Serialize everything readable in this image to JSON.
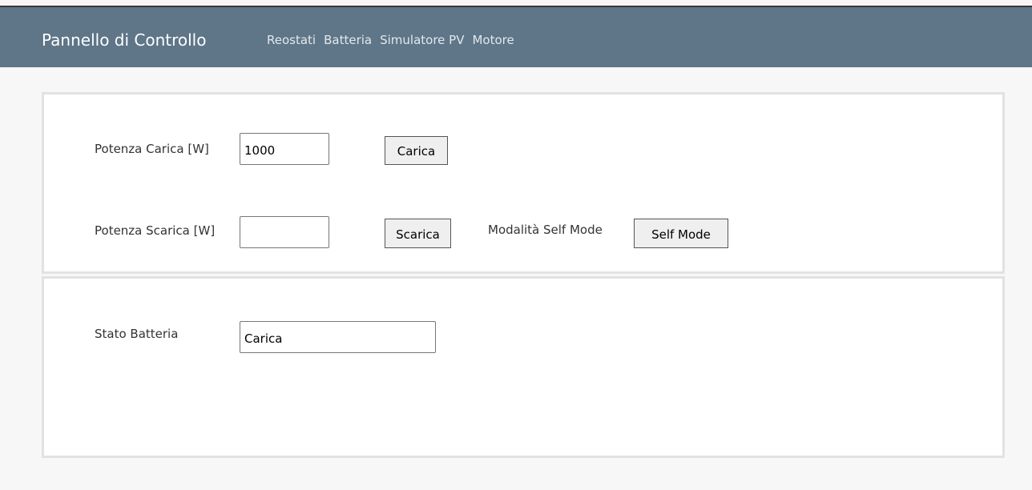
{
  "navbar": {
    "brand": "Pannello di Controllo",
    "links": [
      "Reostati",
      "Batteria",
      "Simulatore PV",
      "Motore"
    ]
  },
  "controls": {
    "charge_power_label": "Potenza Carica [W]",
    "charge_power_value": "1000",
    "charge_button": "Carica",
    "discharge_power_label": "Potenza Scarica [W]",
    "discharge_power_value": "",
    "discharge_button": "Scarica",
    "self_mode_label": "Modalità Self Mode",
    "self_mode_button": "Self Mode"
  },
  "status": {
    "battery_state_label": "Stato Batteria",
    "battery_state_value": "Carica"
  },
  "colors": {
    "navbar_bg": "#5f7588",
    "page_bg": "#f7f7f7",
    "panel_border": "#e2e2e2"
  }
}
